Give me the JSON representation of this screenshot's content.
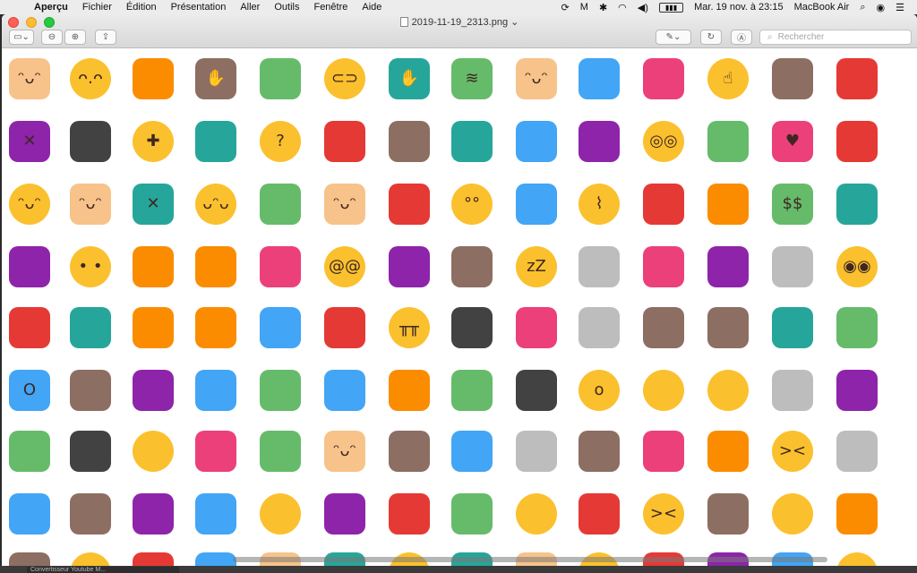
{
  "menubar": {
    "app": "Aperçu",
    "items": [
      "Fichier",
      "Édition",
      "Présentation",
      "Aller",
      "Outils",
      "Fenêtre",
      "Aide"
    ],
    "datetime": "Mar. 19 nov. à 23:15",
    "machine": "MacBook Air",
    "battery_icon": "battery-icon"
  },
  "window": {
    "title": "2019-11-19_2313.png",
    "search_placeholder": "Rechercher"
  },
  "bottom": {
    "tab_label": "Convertisseur Youtube M..."
  },
  "colors": {
    "yellow": "#fbc02d",
    "skin": "#f7c38a",
    "red": "#e53935",
    "green": "#66bb6a",
    "teal": "#26a69a",
    "purple": "#8e24aa",
    "pink": "#ec407a",
    "brown": "#8d6e63",
    "blue": "#42a5f5",
    "grey": "#bdbdbd",
    "orange": "#fb8c00",
    "dark": "#424242"
  },
  "grid": {
    "rows": [
      [
        [
          "older-man",
          "skin",
          "ᵔᴗᵔ"
        ],
        [
          "lying-face",
          "yellow",
          "ᴖ.ᴖ"
        ],
        [
          "tangerine",
          "orange",
          ""
        ],
        [
          "see-no-evil-monkey",
          "brown",
          "✋"
        ],
        [
          "watermelon",
          "green",
          ""
        ],
        [
          "rolling-laughing",
          "yellow",
          "⊂⊃"
        ],
        [
          "man-tipping-hand",
          "teal",
          "✋"
        ],
        [
          "nauseated-face",
          "green",
          "≋"
        ],
        [
          "man",
          "skin",
          "ᵔᴗᵔ"
        ],
        [
          "family-men",
          "blue",
          ""
        ],
        [
          "mermaid",
          "pink",
          ""
        ],
        [
          "index-pointing-up",
          "yellow",
          "☝"
        ],
        [
          "poultry-leg",
          "brown",
          ""
        ],
        [
          "clown-face",
          "red",
          ""
        ]
      ],
      [
        [
          "woman-gesturing-no",
          "purple",
          "✕"
        ],
        [
          "women-bunny-ears",
          "dark",
          ""
        ],
        [
          "bandaged-face",
          "yellow",
          "✚"
        ],
        [
          "man-teacher",
          "teal",
          ""
        ],
        [
          "thinking-face",
          "yellow",
          "?"
        ],
        [
          "meat-on-bone",
          "red",
          ""
        ],
        [
          "horse-racing",
          "brown",
          ""
        ],
        [
          "classical-building",
          "teal",
          ""
        ],
        [
          "woman-mechanic",
          "blue",
          ""
        ],
        [
          "woman-technologist",
          "purple",
          ""
        ],
        [
          "nerd-face",
          "yellow",
          "◎◎"
        ],
        [
          "dragon",
          "green",
          ""
        ],
        [
          "couple-heart",
          "pink",
          "♥"
        ],
        [
          "french-fries",
          "red",
          ""
        ]
      ],
      [
        [
          "slightly-smiling",
          "yellow",
          "ᵔᴗᵔ"
        ],
        [
          "girl",
          "skin",
          "ᵔᴗᵔ"
        ],
        [
          "man-gesturing-no",
          "teal",
          "✕"
        ],
        [
          "upside-down-face",
          "yellow",
          "ᴗᵔᴗ"
        ],
        [
          "stadium",
          "green",
          ""
        ],
        [
          "woman",
          "skin",
          "ᵔᴗᵔ"
        ],
        [
          "red-apple",
          "red",
          ""
        ],
        [
          "face-rolling-eyes",
          "yellow",
          "°°"
        ],
        [
          "dolphin",
          "blue",
          ""
        ],
        [
          "zipper-mouth",
          "yellow",
          "⌇"
        ],
        [
          "woman-dancing",
          "red",
          ""
        ],
        [
          "pineapple",
          "orange",
          ""
        ],
        [
          "money-mouth",
          "green",
          "$$"
        ],
        [
          "man-facepalming",
          "teal",
          ""
        ]
      ],
      [
        [
          "mage",
          "purple",
          ""
        ],
        [
          "face-no-mouth",
          "yellow",
          "• •"
        ],
        [
          "pizza",
          "orange",
          ""
        ],
        [
          "cat",
          "orange",
          ""
        ],
        [
          "tongue",
          "pink",
          ""
        ],
        [
          "dizzy-face",
          "yellow",
          "@@"
        ],
        [
          "woman-gesturing-ok",
          "purple",
          ""
        ],
        [
          "camel",
          "brown",
          ""
        ],
        [
          "sleeping-face",
          "yellow",
          "zZ"
        ],
        [
          "older-woman",
          "grey",
          ""
        ],
        [
          "fairy",
          "pink",
          ""
        ],
        [
          "weight-lifter",
          "purple",
          ""
        ],
        [
          "mosque",
          "grey",
          ""
        ],
        [
          "flushed-face",
          "yellow",
          "◉◉"
        ]
      ],
      [
        [
          "lips",
          "red",
          ""
        ],
        [
          "man-gesturing-ok",
          "teal",
          ""
        ],
        [
          "fox",
          "orange",
          ""
        ],
        [
          "smirking-cat",
          "orange",
          ""
        ],
        [
          "family",
          "blue",
          ""
        ],
        [
          "house",
          "red",
          ""
        ],
        [
          "weary-face",
          "yellow",
          "╥╥"
        ],
        [
          "women-bunny-ears-2",
          "dark",
          ""
        ],
        [
          "pig-nose",
          "pink",
          ""
        ],
        [
          "poodle",
          "grey",
          ""
        ],
        [
          "man-detective",
          "brown",
          ""
        ],
        [
          "monkey-covering",
          "brown",
          ""
        ],
        [
          "woman-technologist-2",
          "teal",
          ""
        ],
        [
          "t-rex",
          "green",
          ""
        ]
      ],
      [
        [
          "screaming-fear",
          "blue",
          "O"
        ],
        [
          "blowfish",
          "brown",
          ""
        ],
        [
          "woman-facepalming",
          "purple",
          ""
        ],
        [
          "cold-sweat",
          "blue",
          ""
        ],
        [
          "chinese-dragon",
          "green",
          ""
        ],
        [
          "family-man-kids",
          "blue",
          ""
        ],
        [
          "horse",
          "orange",
          ""
        ],
        [
          "pear",
          "green",
          ""
        ],
        [
          "woman-office-worker",
          "dark",
          ""
        ],
        [
          "hushed-face",
          "yellow",
          "o"
        ],
        [
          "helicopter",
          "yellow",
          ""
        ],
        [
          "clapping-hands",
          "yellow",
          ""
        ],
        [
          "zebra",
          "grey",
          ""
        ],
        [
          "woman-bowing",
          "purple",
          ""
        ]
      ],
      [
        [
          "woman-farmer",
          "green",
          ""
        ],
        [
          "gorilla",
          "dark",
          ""
        ],
        [
          "steam-from-nose",
          "yellow",
          ""
        ],
        [
          "peach",
          "pink",
          ""
        ],
        [
          "tram-car",
          "green",
          ""
        ],
        [
          "boy",
          "skin",
          "ᵔᴗᵔ"
        ],
        [
          "deer",
          "brown",
          ""
        ],
        [
          "fearful-face",
          "blue",
          ""
        ],
        [
          "older-adult",
          "grey",
          ""
        ],
        [
          "monkey",
          "brown",
          ""
        ],
        [
          "family-man-girls",
          "pink",
          ""
        ],
        [
          "pouting-cat",
          "orange",
          ""
        ],
        [
          "persevering-face",
          "yellow",
          "><"
        ],
        [
          "rabbit",
          "grey",
          ""
        ]
      ],
      [
        [
          "family-2",
          "blue",
          ""
        ],
        [
          "hamburger",
          "brown",
          ""
        ],
        [
          "woman-raising-hand",
          "purple",
          ""
        ],
        [
          "snowboarder",
          "blue",
          ""
        ],
        [
          "crying-face",
          "yellow",
          ""
        ],
        [
          "woman-getting-massage",
          "purple",
          ""
        ],
        [
          "rainbow",
          "red",
          ""
        ],
        [
          "juggling",
          "green",
          ""
        ],
        [
          "backhand-index-left",
          "yellow",
          ""
        ],
        [
          "cherries",
          "red",
          ""
        ],
        [
          "confounded-face",
          "yellow",
          "><"
        ],
        [
          "bear",
          "brown",
          ""
        ],
        [
          "tropical-fish",
          "yellow",
          ""
        ],
        [
          "taco",
          "orange",
          ""
        ]
      ],
      [
        [
          "bear-2",
          "brown",
          ""
        ],
        [
          "face-2",
          "yellow",
          ""
        ],
        [
          "firefighter",
          "red",
          ""
        ],
        [
          "men-holding-hands",
          "blue",
          ""
        ],
        [
          "woman-2",
          "skin",
          ""
        ],
        [
          "tram",
          "teal",
          ""
        ],
        [
          "winking-face",
          "yellow",
          ""
        ],
        [
          "man-2",
          "teal",
          ""
        ],
        [
          "woman-raising-2",
          "skin",
          ""
        ],
        [
          "face-3",
          "yellow",
          ""
        ],
        [
          "locomotive",
          "red",
          ""
        ],
        [
          "mage-2",
          "purple",
          ""
        ],
        [
          "family-3",
          "blue",
          ""
        ],
        [
          "expressionless",
          "yellow",
          ""
        ]
      ]
    ]
  }
}
